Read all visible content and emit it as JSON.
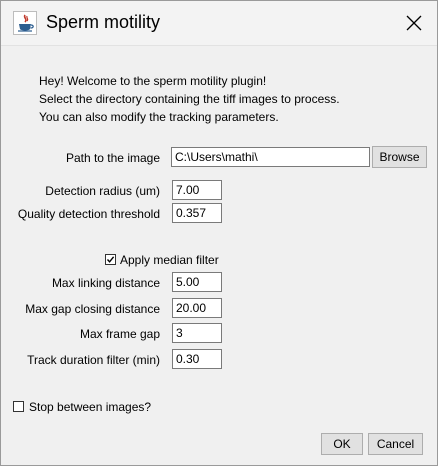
{
  "window": {
    "title": "Sperm motility",
    "close_icon": "close-icon",
    "app_icon": "java-icon"
  },
  "intro": {
    "line1": "Hey! Welcome to the sperm motility plugin!",
    "line2": "Select the directory containing the tiff images to process.",
    "line3": "You can also modify the tracking parameters."
  },
  "path": {
    "label": "Path to the image",
    "value": "C:\\Users\\mathi\\",
    "browse_label": "Browse"
  },
  "detection_radius": {
    "label": "Detection radius (um)",
    "value": "7.00"
  },
  "quality_threshold": {
    "label": "Quality detection threshold",
    "value": "0.357"
  },
  "median_filter": {
    "label": "Apply median filter",
    "checked": true
  },
  "max_linking": {
    "label": "Max linking distance",
    "value": "5.00"
  },
  "max_gap_closing": {
    "label": "Max gap closing distance",
    "value": "20.00"
  },
  "max_frame_gap": {
    "label": "Max frame gap",
    "value": "3"
  },
  "track_duration": {
    "label": "Track duration filter (min)",
    "value": "0.30"
  },
  "stop_between": {
    "label": "Stop between images?",
    "checked": false
  },
  "buttons": {
    "ok_label": "OK",
    "cancel_label": "Cancel"
  }
}
